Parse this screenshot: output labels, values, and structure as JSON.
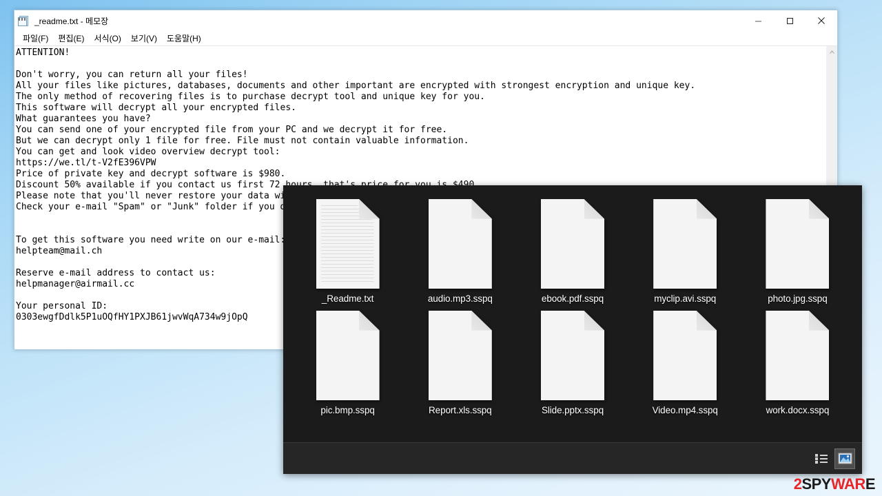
{
  "desktop": {
    "background_top": "#7ec2ef",
    "background_bottom": "#eaf5fd"
  },
  "notepad": {
    "title": "_readme.txt - 메모장",
    "icon": "notepad-icon",
    "window_buttons": {
      "minimize": "minimize-icon",
      "maximize": "maximize-icon",
      "close": "close-icon"
    },
    "menu": [
      {
        "label": "파일(F)",
        "name": "file"
      },
      {
        "label": "편집(E)",
        "name": "edit"
      },
      {
        "label": "서식(O)",
        "name": "format"
      },
      {
        "label": "보기(V)",
        "name": "view"
      },
      {
        "label": "도움말(H)",
        "name": "help"
      }
    ],
    "content": "ATTENTION!\n\nDon't worry, you can return all your files!\nAll your files like pictures, databases, documents and other important are encrypted with strongest encryption and unique key.\nThe only method of recovering files is to purchase decrypt tool and unique key for you.\nThis software will decrypt all your encrypted files.\nWhat guarantees you have?\nYou can send one of your encrypted file from your PC and we decrypt it for free.\nBut we can decrypt only 1 file for free. File must not contain valuable information.\nYou can get and look video overview decrypt tool:\nhttps://we.tl/t-V2fE396VPW\nPrice of private key and decrypt software is $980.\nDiscount 50% available if you contact us first 72 hours, that's price for you is $490.\nPlease note that you'll never restore your data without payment.\nCheck your e-mail \"Spam\" or \"Junk\" folder if you don't get answer more than 6 hours.\n\n\nTo get this software you need write on our e-mail:\nhelpteam@mail.ch\n\nReserve e-mail address to contact us:\nhelpmanager@airmail.cc\n\nYour personal ID:\n0303ewgfDdlk5P1uOQfHY1PXJB61jwvWqA734w9jOpQ",
    "scrollbar": {
      "up_arrow": "chevron-up-icon"
    }
  },
  "explorer": {
    "rows": [
      [
        {
          "name": "_Readme.txt",
          "icon": "text-file-icon",
          "lined": true
        },
        {
          "name": "audio.mp3.sspq",
          "icon": "blank-file-icon",
          "lined": false
        },
        {
          "name": "ebook.pdf.sspq",
          "icon": "blank-file-icon",
          "lined": false
        },
        {
          "name": "myclip.avi.sspq",
          "icon": "blank-file-icon",
          "lined": false
        },
        {
          "name": "photo.jpg.sspq",
          "icon": "blank-file-icon",
          "lined": false
        }
      ],
      [
        {
          "name": "pic.bmp.sspq",
          "icon": "blank-file-icon",
          "lined": false
        },
        {
          "name": "Report.xls.sspq",
          "icon": "blank-file-icon",
          "lined": false
        },
        {
          "name": "Slide.pptx.sspq",
          "icon": "blank-file-icon",
          "lined": false
        },
        {
          "name": "Video.mp4.sspq",
          "icon": "blank-file-icon",
          "lined": false
        },
        {
          "name": "work.docx.sspq",
          "icon": "blank-file-icon",
          "lined": false
        }
      ]
    ],
    "statusbar": {
      "details_view": "details-view-icon",
      "large_icons_view": "large-icons-view-icon",
      "active_view": "large-icons-view"
    }
  },
  "watermark": {
    "part1": "2",
    "part2": "SPY",
    "part3": "WAR",
    "part4": "E",
    "color_red": "#e8262a",
    "color_dark": "#1b1b1b"
  }
}
